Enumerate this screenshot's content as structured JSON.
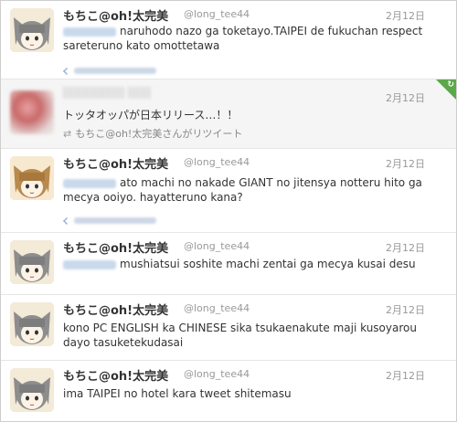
{
  "tweets": [
    {
      "name": "もちこ@oh!太完美",
      "handle": "@long_tee44",
      "date": "2月12日",
      "text": "naruhodo nazo ga toketayo.TAIPEI de fukuchan respect sareteruno kato omottetawa"
    },
    {
      "retweet": true,
      "text": "トッタオッパが日本リリース…！！",
      "retweet_by": "もちこ@oh!太完美さんがリツイート",
      "date": "2月12日"
    },
    {
      "name": "もちこ@oh!太完美",
      "handle": "@long_tee44",
      "date": "2月12日",
      "text": "ato machi no nakade GIANT no jitensya notteru hito ga mecya ooiyo. hayatteruno kana?"
    },
    {
      "name": "もちこ@oh!太完美",
      "handle": "@long_tee44",
      "date": "2月12日",
      "text": "mushiatsui soshite machi zentai ga mecya kusai desu"
    },
    {
      "name": "もちこ@oh!太完美",
      "handle": "@long_tee44",
      "date": "2月12日",
      "text": "kono PC ENGLISH ka CHINESE sika tsukaenakute maji kusoyarou dayo tasuketekudasai"
    },
    {
      "name": "もちこ@oh!太完美",
      "handle": "@long_tee44",
      "date": "2月12日",
      "text": "ima TAIPEI no hotel kara tweet shitemasu"
    }
  ],
  "icons": {
    "avatar": "cat-girl-avatar-icon",
    "retweet": "retweet-icon",
    "reply": "reply-arrow-icon",
    "corner": "retweet-corner-badge-icon"
  },
  "colors": {
    "accent_green": "#5aa84a",
    "link_blue": "#8fb2d8"
  }
}
